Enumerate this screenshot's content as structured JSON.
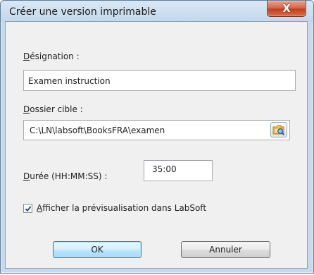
{
  "dialog": {
    "title": "Créer une version imprimable",
    "close_glyph": "X"
  },
  "designation": {
    "label_underlined": "D",
    "label_rest": "ésignation :",
    "value": "Examen instruction"
  },
  "target_folder": {
    "label_underlined": "D",
    "label_rest": "ossier cible :",
    "value": "C:\\LN\\labsoft\\BooksFRA\\examen",
    "browse_icon": "folder-browse-icon"
  },
  "duration": {
    "label_underlined": "D",
    "label_rest": "urée (HH:MM:SS) :",
    "value": "35:00"
  },
  "preview": {
    "checked": true,
    "label_underlined": "A",
    "label_rest": "fficher la prévisualisation dans LabSoft"
  },
  "buttons": {
    "ok": "OK",
    "cancel": "Annuler"
  },
  "colors": {
    "window_frame": "#c7d9ea",
    "client_bg": "#f0f0f0",
    "close_button": "#c7502f",
    "default_button": "#bee6fd"
  }
}
